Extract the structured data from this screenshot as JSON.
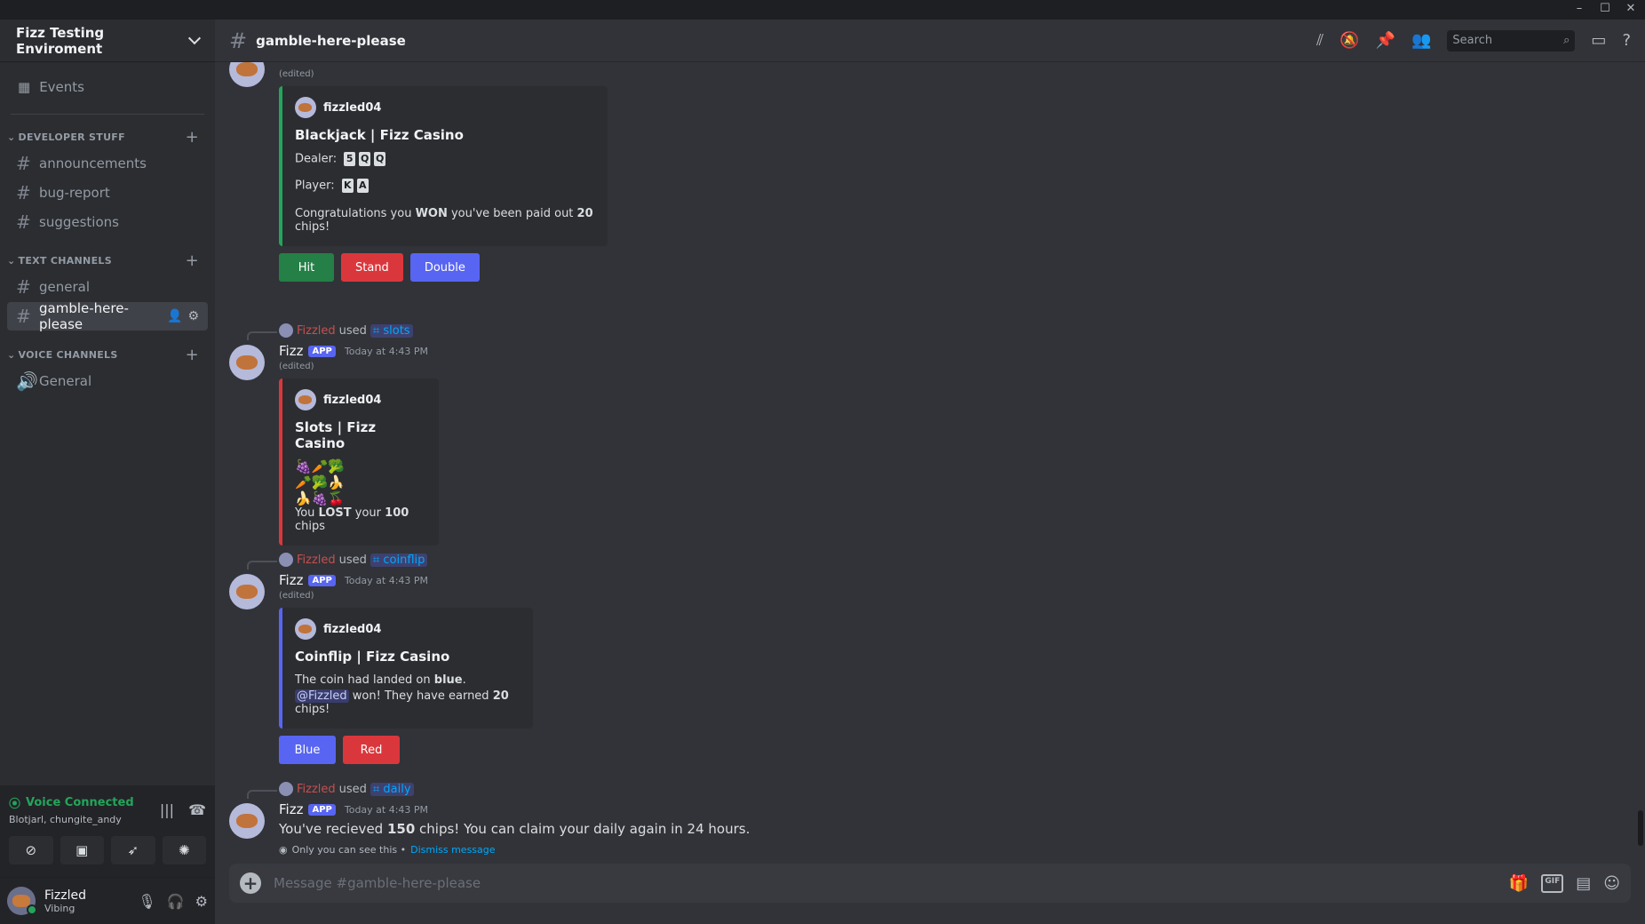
{
  "window": {
    "minimize": "–",
    "maximize": "☐",
    "close": "✕"
  },
  "server": {
    "name": "Fizz Testing Enviroment"
  },
  "sidebar": {
    "events_label": "Events",
    "categories": [
      {
        "name": "DEVELOPER STUFF",
        "channels": [
          "announcements",
          "bug-report",
          "suggestions"
        ]
      },
      {
        "name": "TEXT CHANNELS",
        "channels": [
          "general",
          "gamble-here-please"
        ]
      },
      {
        "name": "VOICE CHANNELS",
        "channels": [
          "General"
        ]
      }
    ]
  },
  "voice": {
    "status": "Voice Connected",
    "members": "Blotjarl, chungite_andy"
  },
  "user": {
    "name": "Fizzled",
    "status": "Vibing"
  },
  "header": {
    "channel": "gamble-here-please",
    "search_placeholder": "Search"
  },
  "messages": {
    "m1": {
      "edited": "(edited)",
      "embed_author": "fizzled04",
      "title": "Blackjack | Fizz Casino",
      "dealer_label": "Dealer:",
      "dealer_cards": [
        "5",
        "Q",
        "Q"
      ],
      "player_label": "Player:",
      "player_cards": [
        "K",
        "A"
      ],
      "result_pre": "Congratulations you ",
      "result_bold": "WON",
      "result_mid": " you've been paid out ",
      "result_amount": "20",
      "result_post": " chips!",
      "buttons": [
        "Hit",
        "Stand",
        "Double"
      ]
    },
    "m2": {
      "reply_user": "Fizzled",
      "reply_used": "used",
      "reply_cmd": "slots",
      "author": "Fizz",
      "tag": "APP",
      "time": "Today at 4:43 PM",
      "edited": "(edited)",
      "embed_author": "fizzled04",
      "title": "Slots | Fizz Casino",
      "reels": [
        "🍇🥕🥦",
        "🥕🥦🍌",
        "🍌🍇🍒"
      ],
      "result_pre": "You ",
      "result_bold": "LOST",
      "result_mid": " your ",
      "result_amount": "100",
      "result_post": " chips"
    },
    "m3": {
      "reply_user": "Fizzled",
      "reply_used": "used",
      "reply_cmd": "coinflip",
      "author": "Fizz",
      "tag": "APP",
      "time": "Today at 4:43 PM",
      "edited": "(edited)",
      "embed_author": "fizzled04",
      "title": "Coinflip | Fizz Casino",
      "line1_pre": "The coin had landed on ",
      "line1_bold": "blue",
      "line1_post": ".",
      "mention": "@Fizzled",
      "line2_mid": " won! They have earned ",
      "line2_amount": "20",
      "line2_post": " chips!",
      "buttons": [
        "Blue",
        "Red"
      ]
    },
    "m4": {
      "reply_user": "Fizzled",
      "reply_used": "used",
      "reply_cmd": "daily",
      "author": "Fizz",
      "tag": "APP",
      "time": "Today at 4:43 PM",
      "text_pre": "You've recieved ",
      "text_bold": "150",
      "text_post": " chips! You can claim your daily again in 24 hours.",
      "only_you": "Only you can see this •",
      "dismiss": "Dismiss message"
    }
  },
  "composer": {
    "placeholder": "Message #gamble-here-please"
  },
  "colors": {
    "accent": "#5865f2",
    "green": "#248046",
    "red": "#da373c",
    "voice_green": "#23a55a"
  }
}
